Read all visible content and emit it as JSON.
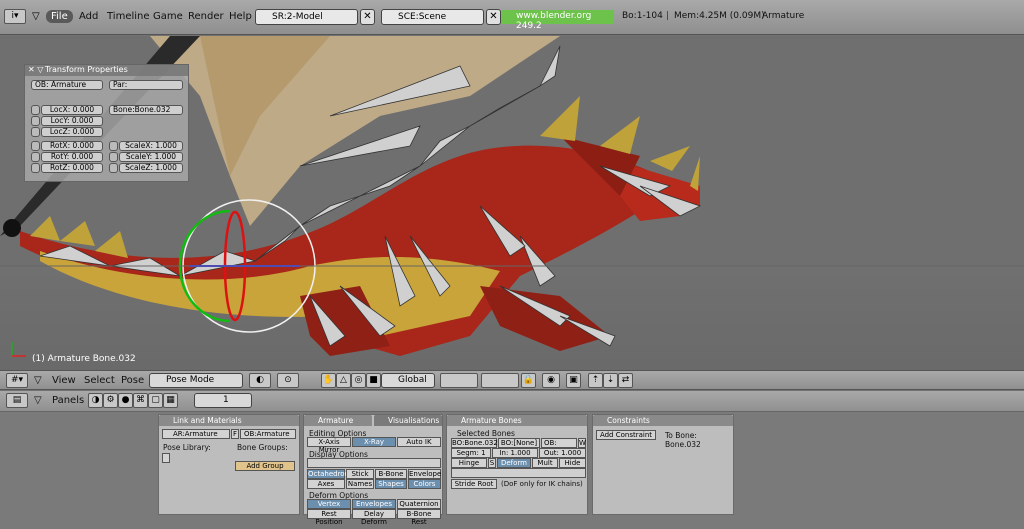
{
  "menubar": {
    "items": [
      "File",
      "Add",
      "Timeline",
      "Game",
      "Render",
      "Help"
    ],
    "screen": "SR:2-Model",
    "scene": "SCE:Scene",
    "url": "www.blender.org 249.2",
    "bones": "Bo:1-104",
    "mem": "Mem:4.25M (0.09M)",
    "object": "Armature"
  },
  "transform": {
    "title": "Transform Properties",
    "ob": "OB: Armature",
    "par": "Par:",
    "bone": "Bone:Bone.032",
    "loc": [
      "LocX: 0.000",
      "LocY: 0.000",
      "LocZ: 0.000"
    ],
    "rot": [
      "RotX: 0.000",
      "RotY: 0.000",
      "RotZ: 0.000"
    ],
    "scale": [
      "ScaleX: 1.000",
      "ScaleY: 1.000",
      "ScaleZ: 1.000"
    ]
  },
  "viewport": {
    "status": "(1) Armature Bone.032"
  },
  "viewheader": {
    "menus": [
      "View",
      "Select",
      "Pose"
    ],
    "mode": "Pose Mode",
    "orientation": "Global"
  },
  "buttons": {
    "panels_label": "Panels",
    "frame": "1",
    "link": {
      "tab": "Link and Materials",
      "ar": "AR:Armature",
      "ob": "OB:Armature",
      "f": "F",
      "pose_library": "Pose Library:",
      "bone_groups": "Bone Groups:",
      "add_group": "Add Group"
    },
    "armature": {
      "tab": "Armature",
      "tab2": "Visualisations",
      "editing": "Editing Options",
      "edit_btns": [
        "X-Axis Mirror",
        "X-Ray",
        "Auto IK"
      ],
      "display": "Display Options",
      "disp_btns1": [
        "Octahedron",
        "Stick",
        "B-Bone",
        "Envelope"
      ],
      "disp_btns2": [
        "Axes",
        "Names",
        "Shapes",
        "Colors"
      ],
      "deform": "Deform Options",
      "def_btns1": [
        "Vertex Groups",
        "Envelopes",
        "Quaternion"
      ],
      "def_btns2": [
        "Rest Position",
        "Delay Deform",
        "B-Bone Rest"
      ]
    },
    "bones": {
      "tab": "Armature Bones",
      "selected": "Selected Bones",
      "bo": "BO:Bone.032",
      "bo2": "BO:[None]",
      "ob": "OB:",
      "w": "W",
      "segm": "Segm: 1",
      "in": "In: 1.000",
      "out": "Out: 1.000",
      "btns": [
        "Hinge",
        "S",
        "Deform",
        "Mult",
        "Hide"
      ],
      "stride": "Stride Root",
      "note": "(DoF only for IK chains)"
    },
    "constraints": {
      "tab": "Constraints",
      "add": "Add Constraint",
      "to_bone": "To Bone: Bone.032"
    }
  },
  "colors": {
    "url_bg": "#6cc24a",
    "selected_btn": "#6d8fae",
    "dragon": "#a8261a",
    "belly": "#c9a43a"
  }
}
